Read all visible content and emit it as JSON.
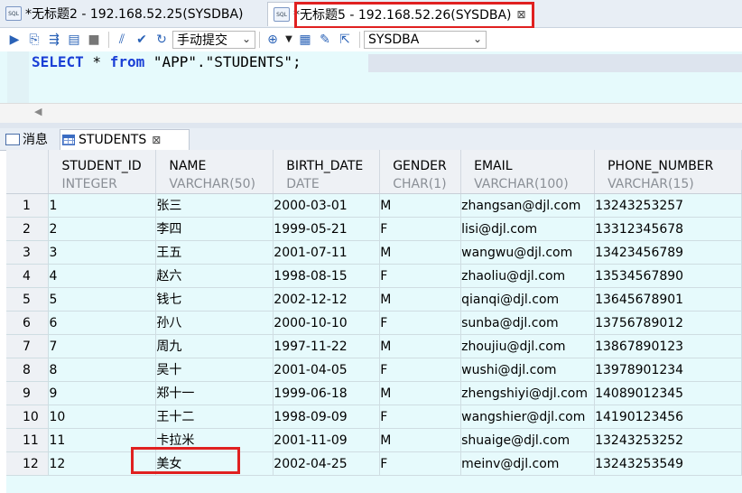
{
  "editor_tabs": [
    {
      "label": "*无标题2 - 192.168.52.25(SYSDBA)",
      "icon": "sql-file-icon"
    },
    {
      "label": "*无标题5 - 192.168.52.26(SYSDBA)",
      "icon": "sql-file-icon"
    }
  ],
  "toolbar": {
    "commit_mode": "手动提交",
    "schema": "SYSDBA"
  },
  "sql": {
    "select_kw": "SELECT",
    "star": " * ",
    "from_kw": "from",
    "rest": " \"APP\".\"STUDENTS\";"
  },
  "result_tabs": [
    {
      "label": "消息",
      "icon": "message-icon"
    },
    {
      "label": "STUDENTS",
      "icon": "grid-icon"
    }
  ],
  "columns": [
    {
      "name": "STUDENT_ID",
      "type": "INTEGER"
    },
    {
      "name": "NAME",
      "type": "VARCHAR(50)"
    },
    {
      "name": "BIRTH_DATE",
      "type": "DATE"
    },
    {
      "name": "GENDER",
      "type": "CHAR(1)"
    },
    {
      "name": "EMAIL",
      "type": "VARCHAR(100)"
    },
    {
      "name": "PHONE_NUMBER",
      "type": "VARCHAR(15)"
    }
  ],
  "rows": [
    [
      "1",
      "1",
      "张三",
      "2000-03-01",
      "M",
      "zhangsan@djl.com",
      "13243253257"
    ],
    [
      "2",
      "2",
      "李四",
      "1999-05-21",
      "F",
      "lisi@djl.com",
      "13312345678"
    ],
    [
      "3",
      "3",
      "王五",
      "2001-07-11",
      "M",
      "wangwu@djl.com",
      "13423456789"
    ],
    [
      "4",
      "4",
      "赵六",
      "1998-08-15",
      "F",
      "zhaoliu@djl.com",
      "13534567890"
    ],
    [
      "5",
      "5",
      "钱七",
      "2002-12-12",
      "M",
      "qianqi@djl.com",
      "13645678901"
    ],
    [
      "6",
      "6",
      "孙八",
      "2000-10-10",
      "F",
      "sunba@djl.com",
      "13756789012"
    ],
    [
      "7",
      "7",
      "周九",
      "1997-11-22",
      "M",
      "zhoujiu@djl.com",
      "13867890123"
    ],
    [
      "8",
      "8",
      "吴十",
      "2001-04-05",
      "F",
      "wushi@djl.com",
      "13978901234"
    ],
    [
      "9",
      "9",
      "郑十一",
      "1999-06-18",
      "M",
      "zhengshiyi@djl.com",
      "14089012345"
    ],
    [
      "10",
      "10",
      "王十二",
      "1998-09-09",
      "F",
      "wangshier@djl.com",
      "14190123456"
    ],
    [
      "11",
      "11",
      "卡拉米",
      "2001-11-09",
      "M",
      "shuaige@djl.com",
      "13243253252"
    ],
    [
      "12",
      "12",
      "美女",
      "2002-04-25",
      "F",
      "meinv@djl.com",
      "13243253549"
    ]
  ]
}
